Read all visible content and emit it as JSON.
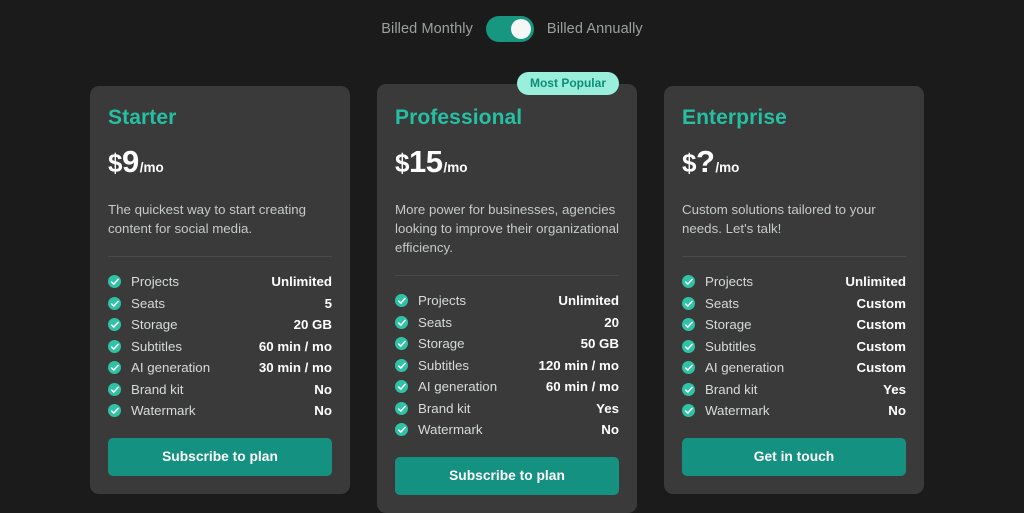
{
  "billing": {
    "monthly_label": "Billed Monthly",
    "annually_label": "Billed Annually",
    "active": "Billed Annually",
    "toggle_name": "billing-period-toggle"
  },
  "colors": {
    "page_bg": "#1b1b1b",
    "card_bg": "#3a3a3a",
    "accent": "#25c0a3",
    "button": "#159182",
    "badge_bg": "#99efdb",
    "badge_text": "#0f8c78"
  },
  "feature_names": [
    "Projects",
    "Seats",
    "Storage",
    "Subtitles",
    "AI generation",
    "Brand kit",
    "Watermark"
  ],
  "plans": [
    {
      "name": "Starter",
      "currency": "$",
      "amount": "9",
      "period": "/mo",
      "description": "The quickest way to start creating content for social media.",
      "badge": "",
      "featured": false,
      "features": [
        {
          "label": "Projects",
          "value": "Unlimited"
        },
        {
          "label": "Seats",
          "value": "5"
        },
        {
          "label": "Storage",
          "value": "20 GB"
        },
        {
          "label": "Subtitles",
          "value": "60 min / mo"
        },
        {
          "label": "AI generation",
          "value": "30 min / mo"
        },
        {
          "label": "Brand kit",
          "value": "No"
        },
        {
          "label": "Watermark",
          "value": "No"
        }
      ],
      "cta": "Subscribe to plan"
    },
    {
      "name": "Professional",
      "currency": "$",
      "amount": "15",
      "period": "/mo",
      "description": "More power for businesses, agencies looking to improve their organizational efficiency.",
      "badge": "Most Popular",
      "featured": true,
      "features": [
        {
          "label": "Projects",
          "value": "Unlimited"
        },
        {
          "label": "Seats",
          "value": "20"
        },
        {
          "label": "Storage",
          "value": "50 GB"
        },
        {
          "label": "Subtitles",
          "value": "120 min / mo"
        },
        {
          "label": "AI generation",
          "value": "60 min / mo"
        },
        {
          "label": "Brand kit",
          "value": "Yes"
        },
        {
          "label": "Watermark",
          "value": "No"
        }
      ],
      "cta": "Subscribe to plan"
    },
    {
      "name": "Enterprise",
      "currency": "$",
      "amount": "?",
      "period": "/mo",
      "description": "Custom solutions tailored to your needs. Let's talk!",
      "badge": "",
      "featured": false,
      "features": [
        {
          "label": "Projects",
          "value": "Unlimited"
        },
        {
          "label": "Seats",
          "value": "Custom"
        },
        {
          "label": "Storage",
          "value": "Custom"
        },
        {
          "label": "Subtitles",
          "value": "Custom"
        },
        {
          "label": "AI generation",
          "value": "Custom"
        },
        {
          "label": "Brand kit",
          "value": "Yes"
        },
        {
          "label": "Watermark",
          "value": "No"
        }
      ],
      "cta": "Get in touch"
    }
  ]
}
